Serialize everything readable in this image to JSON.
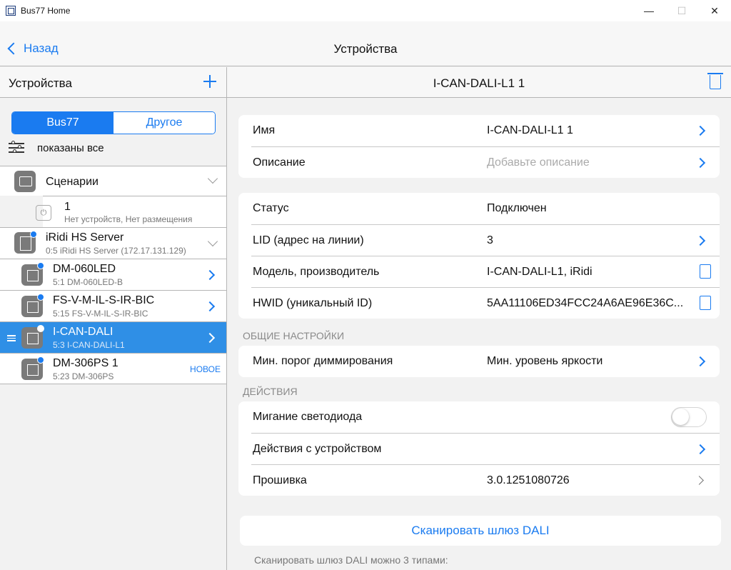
{
  "window": {
    "title": "Bus77 Home",
    "min": "—",
    "max": "☐",
    "close": "✕"
  },
  "nav": {
    "back_label": "Назад",
    "title": "Устройства"
  },
  "left": {
    "header_title": "Устройства",
    "segments": [
      "Bus77",
      "Другое"
    ],
    "filter_text": "показаны все",
    "rows": [
      {
        "title": "Сценарии"
      },
      {
        "title": "1",
        "sub": "Нет устройств, Нет размещения"
      },
      {
        "title": "iRidi HS Server",
        "sub": "0:5 iRidi HS Server (172.17.131.129)"
      },
      {
        "title": "DM-060LED",
        "sub": "5:1 DM-060LED-B"
      },
      {
        "title": "FS-V-M-IL-S-IR-BIC",
        "sub": "5:15 FS-V-M-IL-S-IR-BIC"
      },
      {
        "title": "I-CAN-DALI",
        "sub": "5:3 I-CAN-DALI-L1"
      },
      {
        "title": "DM-306PS 1",
        "sub": "5:23 DM-306PS",
        "badge": "НОВОЕ"
      }
    ]
  },
  "detail": {
    "title": "I-CAN-DALI-L1 1",
    "card1": [
      {
        "k": "Имя",
        "v": "I-CAN-DALI-L1 1"
      },
      {
        "k": "Описание",
        "v": "Добавьте описание"
      }
    ],
    "card2": [
      {
        "k": "Статус",
        "v": "Подключен"
      },
      {
        "k": "LID (адрес на линии)",
        "v": "3"
      },
      {
        "k": "Модель, производитель",
        "v": "I-CAN-DALI-L1, iRidi"
      },
      {
        "k": "HWID (уникальный ID)",
        "v": "5AA11106ED34FCC24A6AE96E36C..."
      }
    ],
    "section_general": "ОБЩИЕ НАСТРОЙКИ",
    "card3": [
      {
        "k": "Мин. порог диммирования",
        "v": "Мин. уровень яркости"
      }
    ],
    "section_actions": "ДЕЙСТВИЯ",
    "card4": [
      {
        "k": "Мигание светодиода",
        "v": ""
      },
      {
        "k": "Действия с устройством",
        "v": ""
      },
      {
        "k": "Прошивка",
        "v": "3.0.1251080726"
      }
    ],
    "scan_button": "Сканировать шлюз DALI",
    "footnote_line1": "Сканировать шлюз DALI можно 3 типами:"
  },
  "colors": {
    "accent": "#1a7bf0",
    "selected_row": "#2f8fe6"
  }
}
